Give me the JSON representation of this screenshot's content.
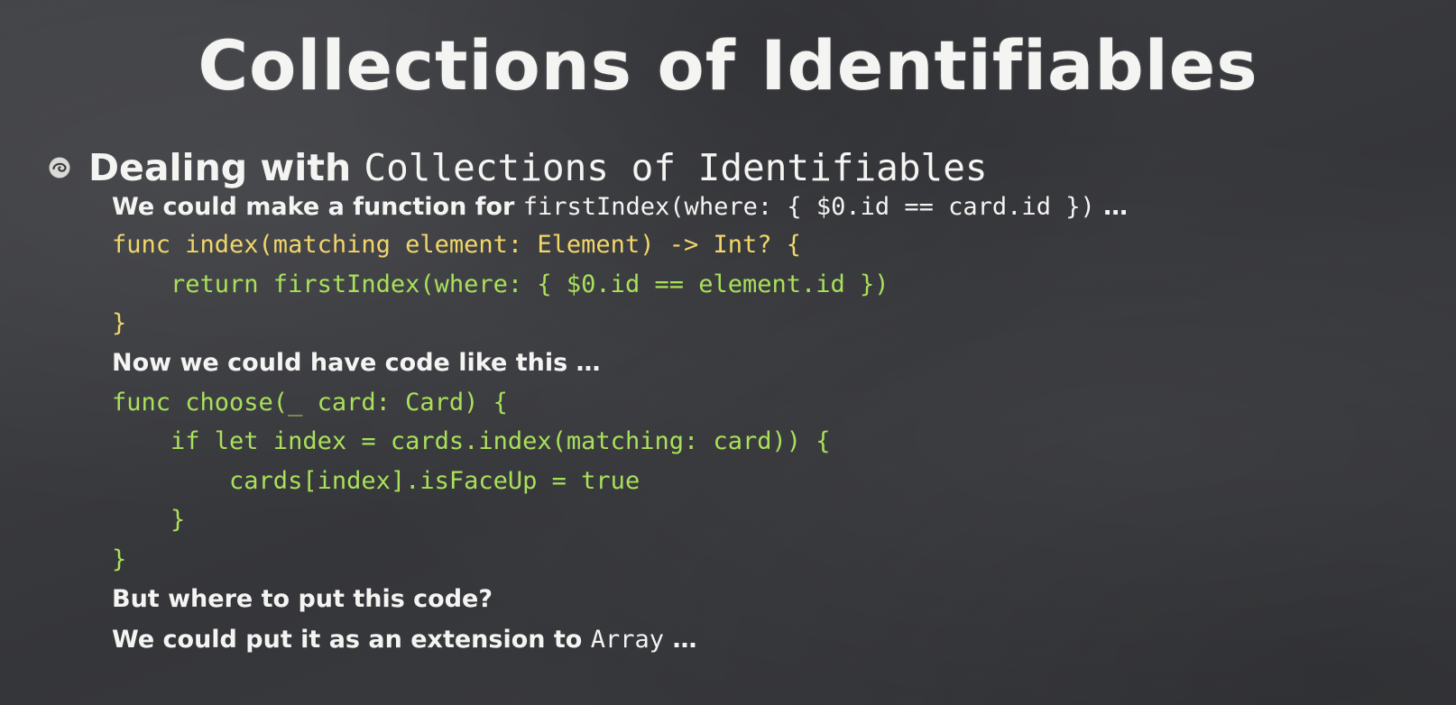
{
  "title": "Collections of Identifiables",
  "bullet": {
    "prefix": "Dealing with ",
    "code": "Collections of Identifiables",
    "icon": "bullet-swirl-icon"
  },
  "colors": {
    "background": "#3b3c3e",
    "text": "#f4f4f2",
    "code_yellow": "#f1d66a",
    "code_green": "#a9e05a"
  },
  "lines": [
    {
      "prefix": "We could make a function for ",
      "code": "firstIndex(where: { $0.id == card.id })",
      "suffix": " …"
    },
    {
      "code": "func index(matching element: Element) -> Int? {"
    },
    {
      "code": "    return firstIndex(where: { $0.id == element.id })"
    },
    {
      "code": "}"
    },
    {
      "text": "Now we could have code like this …"
    },
    {
      "code": "func choose(_ card: Card) {"
    },
    {
      "code": "    if let index = cards.index(matching: card)) {"
    },
    {
      "code": "        cards[index].isFaceUp = true"
    },
    {
      "code": "    }"
    },
    {
      "code": "}"
    },
    {
      "text": "But where to put this code?"
    },
    {
      "prefix": "We could put it as an extension to ",
      "code": "Array",
      "suffix": " …"
    }
  ]
}
